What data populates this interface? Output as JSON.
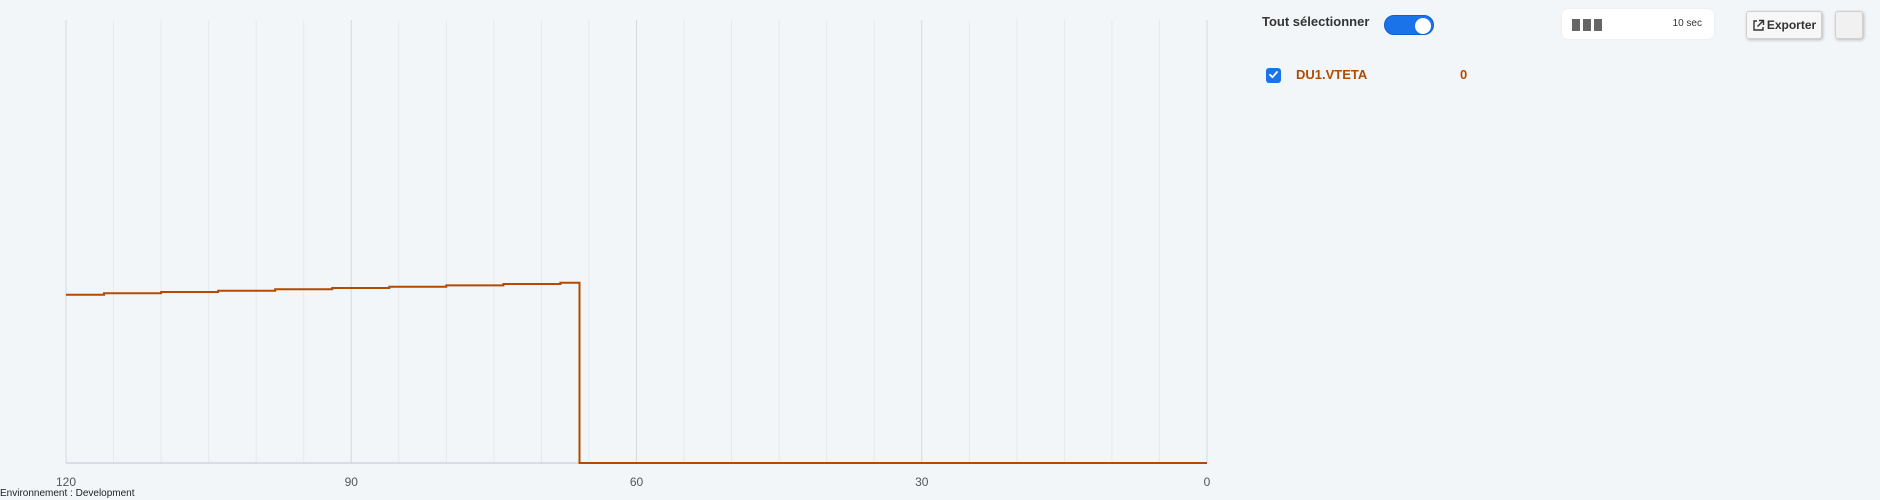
{
  "environment_label": "Environnement : Development",
  "controls": {
    "select_all_label": "Tout sélectionner",
    "select_all_on": true,
    "period_label": "10 sec",
    "export_label": "Exporter"
  },
  "series_list": [
    {
      "name": "DU1.VTETA",
      "value": "0",
      "checked": true,
      "color": "#b34a00"
    }
  ],
  "chart_data": {
    "type": "line",
    "title": "",
    "xlabel": "",
    "ylabel": "",
    "x_ticks": [
      "120",
      "90",
      "60",
      "30",
      "0"
    ],
    "xlim": [
      120,
      0
    ],
    "ylim": [
      0,
      1
    ],
    "grid": true,
    "series": [
      {
        "color": "#b34a00",
        "step": true,
        "x": [
          120,
          116,
          110,
          104,
          98,
          92,
          86,
          80,
          74,
          68,
          66,
          66,
          0
        ],
        "y": [
          0.38,
          0.383,
          0.386,
          0.389,
          0.392,
          0.395,
          0.398,
          0.401,
          0.404,
          0.407,
          0.407,
          0,
          0
        ]
      }
    ]
  }
}
